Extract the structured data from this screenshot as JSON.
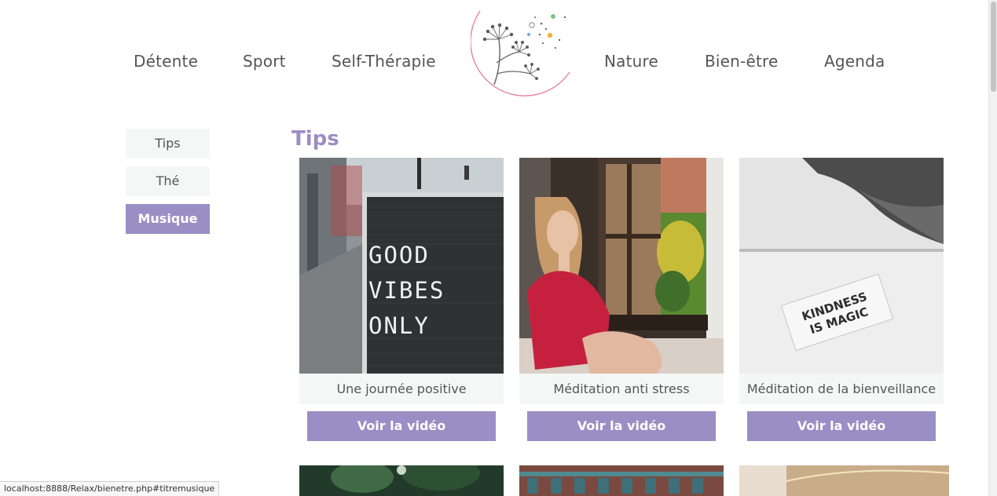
{
  "nav": {
    "left": [
      "Détente",
      "Sport",
      "Self-Thérapie"
    ],
    "right": [
      "Nature",
      "Bien-être",
      "Agenda"
    ]
  },
  "side_menu": [
    {
      "label": "Tips",
      "active": false
    },
    {
      "label": "Thé",
      "active": false
    },
    {
      "label": "Musique",
      "active": true
    }
  ],
  "section": {
    "title": "Tips"
  },
  "cards": [
    {
      "caption": "Une journée positive",
      "button": "Voir la vidéo",
      "image": "letterboard-good-vibes-photo",
      "sign_text": [
        "GOOD",
        "VIBES",
        "ONLY"
      ]
    },
    {
      "caption": "Méditation anti stress",
      "button": "Voir la vidéo",
      "image": "woman-at-window-photo"
    },
    {
      "caption": "Méditation de la bienveillance",
      "button": "Voir la vidéo",
      "image": "kindness-card-photo",
      "sign_text": [
        "KINDNESS",
        "IS MAGIC"
      ]
    }
  ],
  "status_bar": {
    "url": "localhost:8888/Relax/bienetre.php#titremusique"
  },
  "colors": {
    "accent": "#9b8ec4",
    "text": "#555555",
    "caption_bg": "#f5f7f6"
  }
}
